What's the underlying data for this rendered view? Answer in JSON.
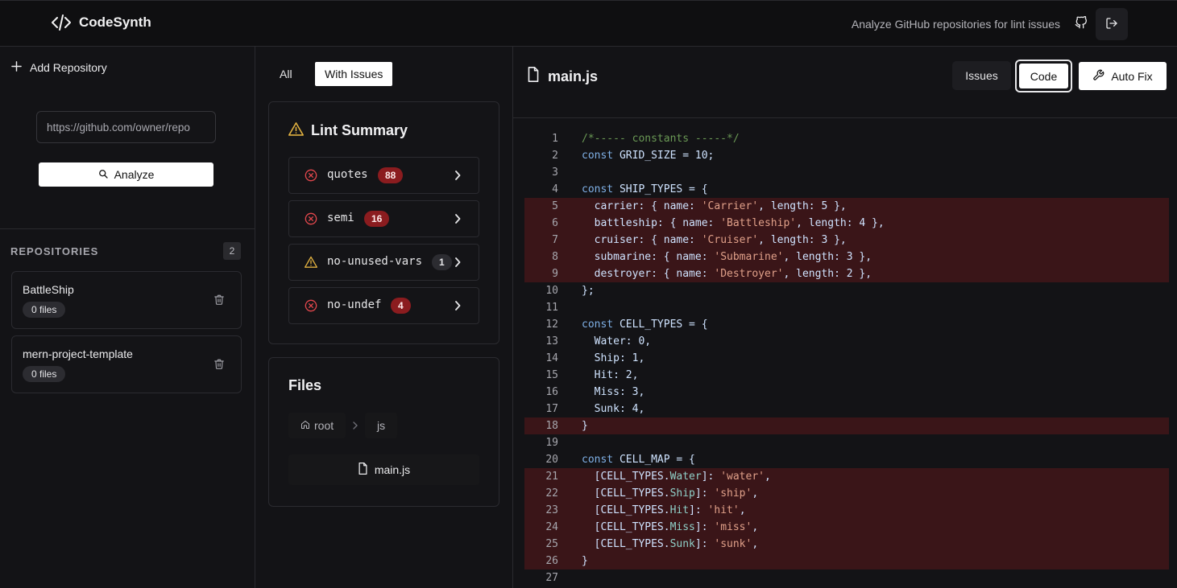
{
  "header": {
    "brand": "CodeSynth",
    "tagline": "Analyze GitHub repositories for lint issues",
    "icons": {
      "brand": "code-brackets-icon",
      "github": "github-icon",
      "logout": "logout-icon"
    }
  },
  "sidebar": {
    "add_repo_label": "Add Repository",
    "url_placeholder": "https://github.com/owner/repo",
    "analyze_label": "Analyze",
    "repos_title": "REPOSITORIES",
    "repos_count": "2",
    "repos": [
      {
        "name": "BattleShip",
        "files": "0 files"
      },
      {
        "name": "mern-project-template",
        "files": "0 files"
      }
    ]
  },
  "middle": {
    "filters": {
      "all": "All",
      "with_issues": "With Issues"
    },
    "lint_summary": {
      "title": "Lint Summary",
      "rules": [
        {
          "name": "quotes",
          "count": "88",
          "severity": "error"
        },
        {
          "name": "semi",
          "count": "16",
          "severity": "error"
        },
        {
          "name": "no-unused-vars",
          "count": "1",
          "severity": "warning"
        },
        {
          "name": "no-undef",
          "count": "4",
          "severity": "error"
        }
      ]
    },
    "files": {
      "title": "Files",
      "breadcrumb": {
        "root": "root",
        "folder": "js"
      },
      "items": [
        {
          "name": "main.js"
        }
      ]
    }
  },
  "viewer": {
    "file_name": "main.js",
    "tabs": {
      "issues": "Issues",
      "code": "Code"
    },
    "autofix_label": "Auto Fix",
    "colors": {
      "error_line_bg": "#3a1518",
      "badge_error": "#8b1c1f",
      "warning": "#e0b040"
    },
    "lines": [
      {
        "n": "1",
        "err": false,
        "tokens": [
          [
            "com",
            "/*----- constants -----*/"
          ]
        ]
      },
      {
        "n": "2",
        "err": false,
        "tokens": [
          [
            "kw",
            "const "
          ],
          [
            "id",
            "GRID_SIZE = 10;"
          ]
        ]
      },
      {
        "n": "3",
        "err": false,
        "tokens": []
      },
      {
        "n": "4",
        "err": false,
        "tokens": [
          [
            "kw",
            "const "
          ],
          [
            "id",
            "SHIP_TYPES = {"
          ]
        ]
      },
      {
        "n": "5",
        "err": true,
        "tokens": [
          [
            "id",
            "  carrier: { name: "
          ],
          [
            "str",
            "'Carrier'"
          ],
          [
            "id",
            ", length: 5 },"
          ]
        ]
      },
      {
        "n": "6",
        "err": true,
        "tokens": [
          [
            "id",
            "  battleship: { name: "
          ],
          [
            "str",
            "'Battleship'"
          ],
          [
            "id",
            ", length: 4 },"
          ]
        ]
      },
      {
        "n": "7",
        "err": true,
        "tokens": [
          [
            "id",
            "  cruiser: { name: "
          ],
          [
            "str",
            "'Cruiser'"
          ],
          [
            "id",
            ", length: 3 },"
          ]
        ]
      },
      {
        "n": "8",
        "err": true,
        "tokens": [
          [
            "id",
            "  submarine: { name: "
          ],
          [
            "str",
            "'Submarine'"
          ],
          [
            "id",
            ", length: 3 },"
          ]
        ]
      },
      {
        "n": "9",
        "err": true,
        "tokens": [
          [
            "id",
            "  destroyer: { name: "
          ],
          [
            "str",
            "'Destroyer'"
          ],
          [
            "id",
            ", length: 2 },"
          ]
        ]
      },
      {
        "n": "10",
        "err": false,
        "tokens": [
          [
            "id",
            "};"
          ]
        ]
      },
      {
        "n": "11",
        "err": false,
        "tokens": []
      },
      {
        "n": "12",
        "err": false,
        "tokens": [
          [
            "kw",
            "const "
          ],
          [
            "id",
            "CELL_TYPES = {"
          ]
        ]
      },
      {
        "n": "13",
        "err": false,
        "tokens": [
          [
            "id",
            "  Water: 0,"
          ]
        ]
      },
      {
        "n": "14",
        "err": false,
        "tokens": [
          [
            "id",
            "  Ship: 1,"
          ]
        ]
      },
      {
        "n": "15",
        "err": false,
        "tokens": [
          [
            "id",
            "  Hit: 2,"
          ]
        ]
      },
      {
        "n": "16",
        "err": false,
        "tokens": [
          [
            "id",
            "  Miss: 3,"
          ]
        ]
      },
      {
        "n": "17",
        "err": false,
        "tokens": [
          [
            "id",
            "  Sunk: 4,"
          ]
        ]
      },
      {
        "n": "18",
        "err": true,
        "tokens": [
          [
            "id",
            "}"
          ]
        ]
      },
      {
        "n": "19",
        "err": false,
        "tokens": []
      },
      {
        "n": "20",
        "err": false,
        "tokens": [
          [
            "kw",
            "const "
          ],
          [
            "id",
            "CELL_MAP = {"
          ]
        ]
      },
      {
        "n": "21",
        "err": true,
        "tokens": [
          [
            "id",
            "  [CELL_TYPES."
          ],
          [
            "prop",
            "Water"
          ],
          [
            "id",
            "]: "
          ],
          [
            "str",
            "'water'"
          ],
          [
            "id",
            ","
          ]
        ]
      },
      {
        "n": "22",
        "err": true,
        "tokens": [
          [
            "id",
            "  [CELL_TYPES."
          ],
          [
            "prop",
            "Ship"
          ],
          [
            "id",
            "]: "
          ],
          [
            "str",
            "'ship'"
          ],
          [
            "id",
            ","
          ]
        ]
      },
      {
        "n": "23",
        "err": true,
        "tokens": [
          [
            "id",
            "  [CELL_TYPES."
          ],
          [
            "prop",
            "Hit"
          ],
          [
            "id",
            "]: "
          ],
          [
            "str",
            "'hit'"
          ],
          [
            "id",
            ","
          ]
        ]
      },
      {
        "n": "24",
        "err": true,
        "tokens": [
          [
            "id",
            "  [CELL_TYPES."
          ],
          [
            "prop",
            "Miss"
          ],
          [
            "id",
            "]: "
          ],
          [
            "str",
            "'miss'"
          ],
          [
            "id",
            ","
          ]
        ]
      },
      {
        "n": "25",
        "err": true,
        "tokens": [
          [
            "id",
            "  [CELL_TYPES."
          ],
          [
            "prop",
            "Sunk"
          ],
          [
            "id",
            "]: "
          ],
          [
            "str",
            "'sunk'"
          ],
          [
            "id",
            ","
          ]
        ]
      },
      {
        "n": "26",
        "err": true,
        "tokens": [
          [
            "id",
            "}"
          ]
        ]
      },
      {
        "n": "27",
        "err": false,
        "tokens": []
      }
    ]
  }
}
